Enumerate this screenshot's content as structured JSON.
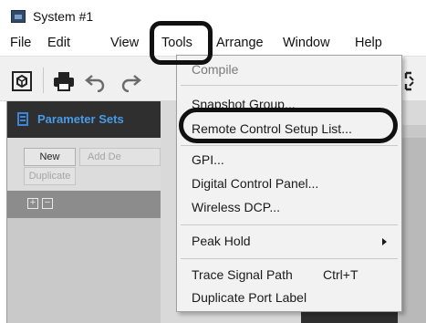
{
  "window": {
    "title": "System #1",
    "app_icon": "system-window-icon"
  },
  "menubar": {
    "items": [
      {
        "label": "File"
      },
      {
        "label": "Edit"
      },
      {
        "label": "View"
      },
      {
        "label": "Tools",
        "open": true,
        "highlighted": true
      },
      {
        "label": "Arrange"
      },
      {
        "label": "Window"
      },
      {
        "label": "Help"
      }
    ]
  },
  "toolbar": {
    "icons": [
      "component-cube-icon",
      "print-icon",
      "undo-icon",
      "redo-icon"
    ]
  },
  "parameter_sets": {
    "title": "Parameter Sets",
    "icon": "list-document-icon",
    "buttons": {
      "new": "New",
      "add_device": "Add De",
      "duplicate": "Duplicate"
    },
    "expand_symbol": "+",
    "collapse_symbol": "−"
  },
  "tools_menu": {
    "items": [
      {
        "label": "Compile",
        "disabled": true
      },
      {
        "label": "Snapshot Group..."
      },
      {
        "label": "Remote Control Setup List...",
        "highlighted": true
      },
      {
        "label": "GPI..."
      },
      {
        "label": "Digital Control Panel..."
      },
      {
        "label": "Wireless DCP..."
      },
      {
        "label": "Peak Hold",
        "submenu": true
      },
      {
        "label": "Trace Signal Path",
        "shortcut": "Ctrl+T"
      },
      {
        "label": "Duplicate Port Label"
      }
    ]
  },
  "colors": {
    "highlight_ring": "#111111",
    "panel_title": "#4a9ae6",
    "panel_header_bg": "#2f2f2f",
    "menu_bg": "#f2f2f2"
  }
}
